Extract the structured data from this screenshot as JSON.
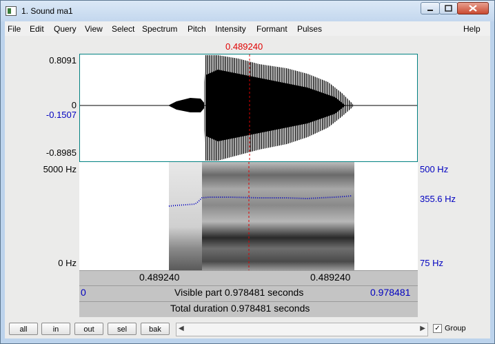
{
  "window": {
    "title": "1. Sound ma1",
    "minimize_label": "–",
    "maximize_label": "□",
    "close_label": "✕"
  },
  "menu": [
    "File",
    "Edit",
    "Query",
    "View",
    "Select",
    "Spectrum",
    "Pitch",
    "Intensity",
    "Formant",
    "Pulses"
  ],
  "help_label": "Help",
  "cursor_time": "0.489240",
  "waveform": {
    "y_max": "0.8091",
    "y_zero": "0",
    "y_cursor": "-0.1507",
    "y_min": "-0.8985"
  },
  "spectrogram": {
    "freq_top": "5000 Hz",
    "freq_bottom": "0 Hz",
    "pitch_top": "500 Hz",
    "pitch_value": "355.6 Hz",
    "pitch_bottom": "75 Hz"
  },
  "time_bar": {
    "left": "0.489240",
    "right": "0.489240"
  },
  "visible_bar": {
    "start": "0",
    "label": "Visible part 0.978481 seconds",
    "end": "0.978481"
  },
  "total_bar": {
    "label": "Total duration 0.978481 seconds"
  },
  "zoom_buttons": [
    "all",
    "in",
    "out",
    "sel",
    "bak"
  ],
  "group": {
    "label": "Group",
    "checked": true
  },
  "colors": {
    "cursor": "#e00000",
    "pitch": "#0000c0",
    "pane_border": "#008080"
  }
}
